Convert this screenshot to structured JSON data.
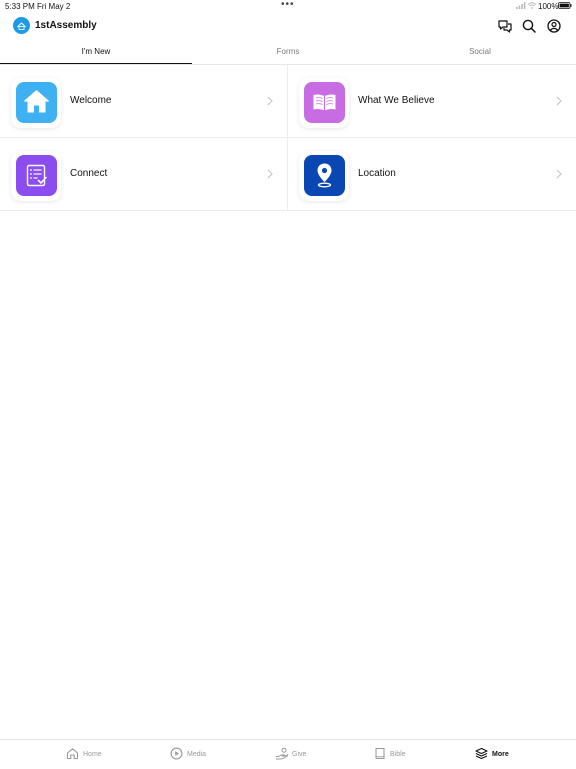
{
  "status_bar": {
    "time": "5:33 PM",
    "date": "Fri May 2",
    "battery_percent": "100%"
  },
  "header": {
    "title": "1stAssembly"
  },
  "tabs": [
    {
      "label": "I'm New",
      "active": true
    },
    {
      "label": "Forms",
      "active": false
    },
    {
      "label": "Social",
      "active": false
    }
  ],
  "cards": [
    {
      "label": "Welcome",
      "icon": "home-icon",
      "color": "#3fb1f2"
    },
    {
      "label": "What We Believe",
      "icon": "open-book-icon",
      "color": "#c86ce3"
    },
    {
      "label": "Connect",
      "icon": "checklist-icon",
      "color": "#8b4cf0"
    },
    {
      "label": "Location",
      "icon": "map-pin-icon",
      "color": "#0b47b3"
    }
  ],
  "bottom_nav": [
    {
      "label": "Home",
      "icon": "home-icon",
      "active": false
    },
    {
      "label": "Media",
      "icon": "play-circle-icon",
      "active": false
    },
    {
      "label": "Give",
      "icon": "give-hand-icon",
      "active": false
    },
    {
      "label": "Bible",
      "icon": "book-icon",
      "active": false
    },
    {
      "label": "More",
      "icon": "layers-icon",
      "active": true
    }
  ],
  "colors": {
    "accent": "#1e9be6",
    "text": "#111111",
    "muted": "#9a9a9a"
  }
}
